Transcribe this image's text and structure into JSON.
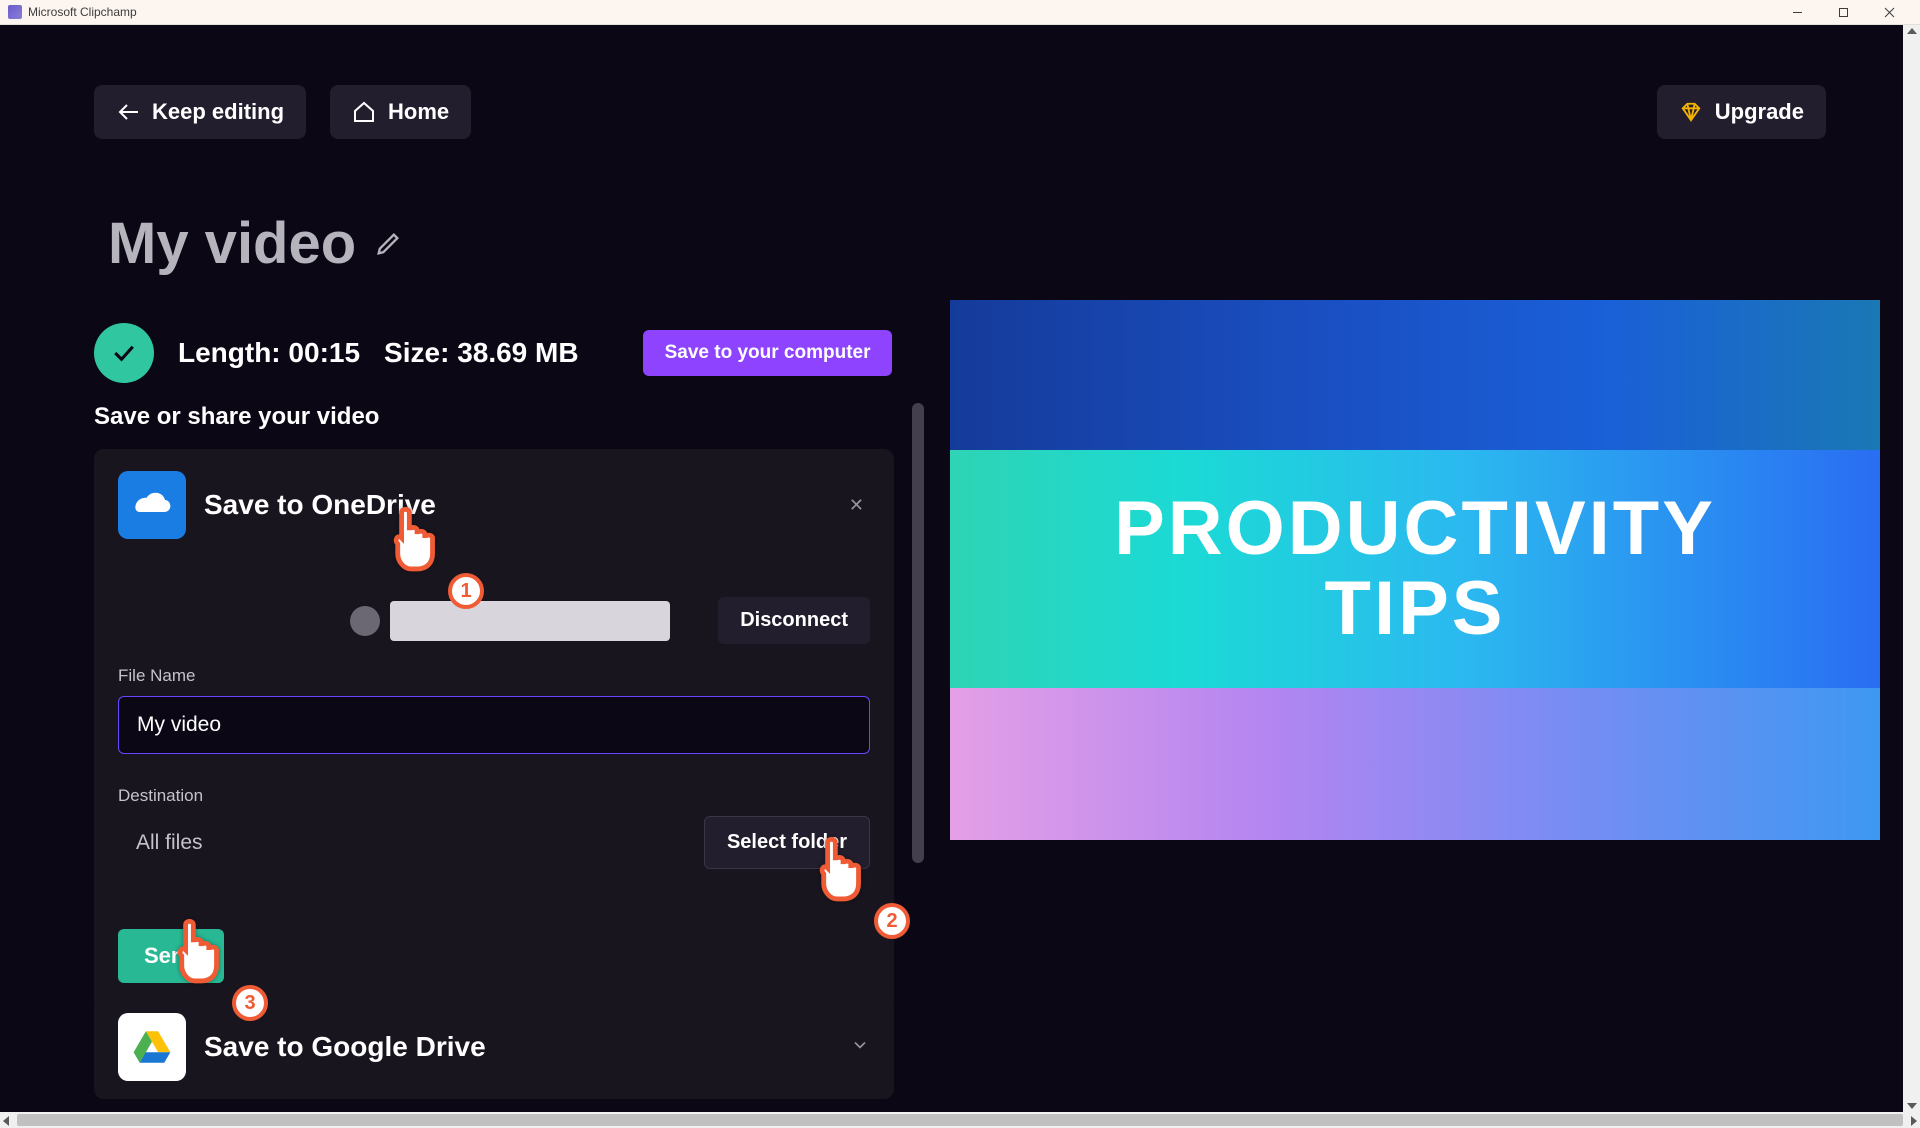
{
  "window": {
    "title": "Microsoft Clipchamp"
  },
  "header": {
    "keep_editing": "Keep editing",
    "home": "Home",
    "upgrade": "Upgrade"
  },
  "video": {
    "title": "My video"
  },
  "status": {
    "length_label": "Length:",
    "length_value": "00:15",
    "size_label": "Size:",
    "size_value": "38.69 MB",
    "save_computer": "Save to your computer"
  },
  "section": {
    "save_share": "Save or share your video"
  },
  "onedrive": {
    "title": "Save to OneDrive",
    "disconnect": "Disconnect",
    "file_name_label": "File Name",
    "file_name_value": "My video",
    "destination_label": "Destination",
    "destination_value": "All files",
    "select_folder": "Select folder",
    "send": "Send"
  },
  "googledrive": {
    "title": "Save to Google Drive"
  },
  "preview": {
    "line1": "PRODUCTIVITY",
    "line2": "TIPS"
  },
  "annotations": {
    "p1": "1",
    "p2": "2",
    "p3": "3"
  }
}
